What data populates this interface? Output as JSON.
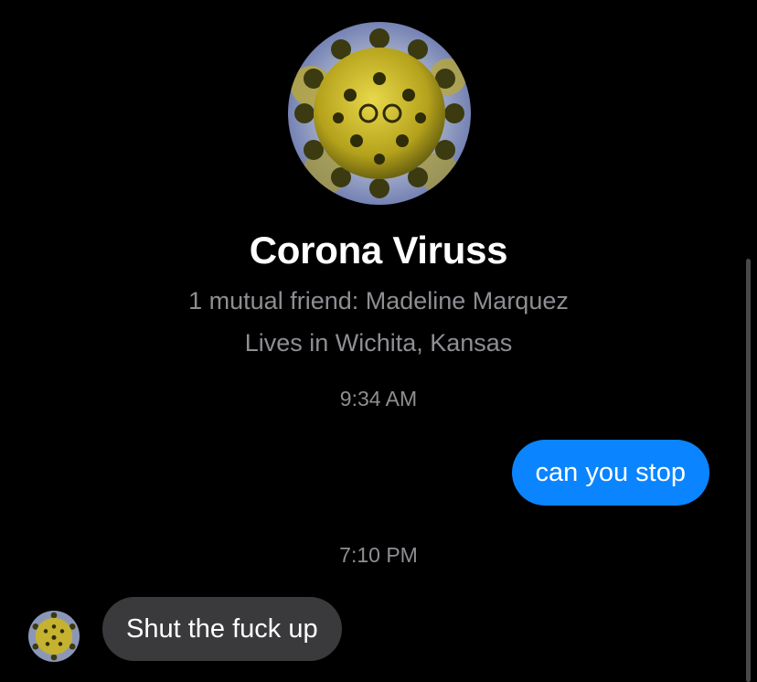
{
  "profile": {
    "avatar_icon": "coronavirus-avatar-icon",
    "name": "Corona Viruss",
    "mutual_friends": "1 mutual friend: Madeline Marquez",
    "location": "Lives in Wichita, Kansas"
  },
  "messages": [
    {
      "timestamp": "9:34 AM",
      "direction": "outgoing",
      "text": "can you stop"
    },
    {
      "timestamp": "7:10 PM",
      "direction": "incoming",
      "text": "Shut the fuck up"
    }
  ],
  "colors": {
    "background": "#000000",
    "outgoing_bubble": "#0a84ff",
    "incoming_bubble": "#3a3a3c",
    "secondary_text": "#8e8e93"
  }
}
